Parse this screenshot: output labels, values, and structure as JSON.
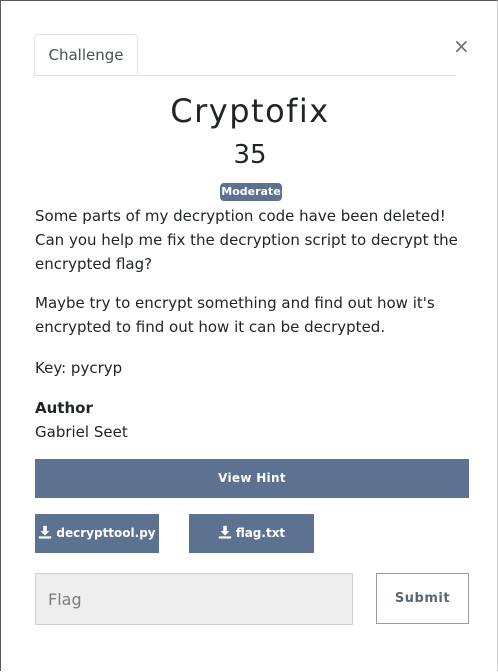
{
  "tabs": [
    {
      "label": "Challenge"
    }
  ],
  "close_label": "×",
  "challenge": {
    "name": "Cryptofix",
    "value": "35",
    "difficulty": "Moderate",
    "description": [
      "Some parts of my decryption code have been deleted! Can you help me fix the decryption script to decrypt the encrypted flag?",
      "Maybe try to encrypt something and find out how it's encrypted to find out how it can be decrypted.",
      "Key: pycryp"
    ],
    "author_label": "Author",
    "author_name": "Gabriel Seet"
  },
  "hint_button": "View Hint",
  "files": [
    {
      "name": "decrypttool.py",
      "icon": "download-icon"
    },
    {
      "name": "flag.txt",
      "icon": "download-icon"
    }
  ],
  "submission": {
    "flag_value": "",
    "flag_placeholder": "Flag",
    "submit_label": "Submit"
  },
  "colors": {
    "accent": "#5c7290",
    "input_bg": "#eeeeee"
  }
}
